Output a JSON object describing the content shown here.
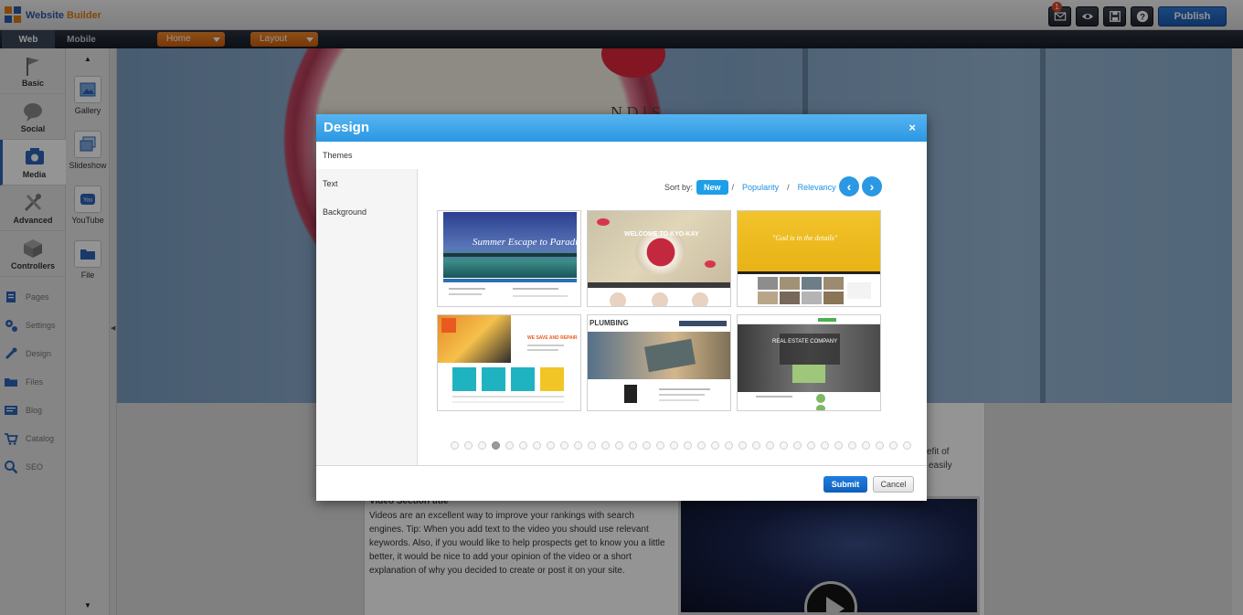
{
  "app": {
    "title": "Website Builder",
    "title_part1": "Website",
    "title_part2": "Builder"
  },
  "toolbar": {
    "messages_badge": "1",
    "publish_label": "Publish",
    "icons": [
      "mail-icon",
      "eye-icon",
      "save-icon",
      "help-icon"
    ]
  },
  "navbar": {
    "modes": [
      "Web",
      "Mobile"
    ],
    "active_mode": "Web",
    "home_dropdown": "Home",
    "layout_dropdown": "Layout"
  },
  "leftcol": {
    "categories": [
      {
        "label": "Basic",
        "icon": "flag-icon"
      },
      {
        "label": "Social",
        "icon": "chat-bubble-icon"
      },
      {
        "label": "Media",
        "icon": "media-icon",
        "active": true
      },
      {
        "label": "Advanced",
        "icon": "tools-icon"
      },
      {
        "label": "Controllers",
        "icon": "box-icon"
      }
    ],
    "links": [
      {
        "label": "Pages",
        "icon": "pages-icon"
      },
      {
        "label": "Settings",
        "icon": "gears-icon"
      },
      {
        "label": "Design",
        "icon": "brush-icon"
      },
      {
        "label": "Files",
        "icon": "folder-icon"
      },
      {
        "label": "Blog",
        "icon": "blog-icon"
      },
      {
        "label": "Catalog",
        "icon": "cart-icon"
      },
      {
        "label": "SEO",
        "icon": "magnifier-icon"
      }
    ]
  },
  "media_panel": {
    "items": [
      {
        "label": "Gallery",
        "icon": "gallery-icon"
      },
      {
        "label": "Slideshow",
        "icon": "slideshow-icon"
      },
      {
        "label": "YouTube",
        "icon": "youtube-icon"
      },
      {
        "label": "File",
        "icon": "file-folder-icon"
      }
    ]
  },
  "page": {
    "hero_title": "N  D  l   S ",
    "side_text_1": "efit of",
    "side_text_2": "easily",
    "video_section_title": "Video Section title",
    "video_section_body": "Videos are an excellent way to improve your rankings with search engines. Tip: When you add text to the video you should use relevant keywords. Also, if you would like to help prospects get to know you a little better, it would be nice to add your opinion of the video or a short explanation of why you decided to create or post it on your site."
  },
  "modal": {
    "title": "Design",
    "close": "×",
    "tabs": [
      "Themes",
      "Text",
      "Background"
    ],
    "active_tab": "Themes",
    "sort_label": "Sort by:",
    "sort_options": [
      "New",
      "Popularity",
      "Relevancy"
    ],
    "sort_active": "New",
    "sort_separator": "/",
    "prev_arrow": "‹",
    "next_arrow": "›",
    "themes": [
      {
        "name": "summer-escape",
        "text": "Summer Escape to Paradise"
      },
      {
        "name": "kyo-kay",
        "text": "WELCOME TO KYO-KAY"
      },
      {
        "name": "details",
        "text": "\"God is in the details\""
      },
      {
        "name": "handyman",
        "text": "WE SAVE AND REPAIR"
      },
      {
        "name": "plumbing",
        "text": "PLUMBING"
      },
      {
        "name": "real-estate",
        "text": "REAL ESTATE COMPANY"
      }
    ],
    "page_dots_count": 34,
    "active_page_index": 3,
    "submit_label": "Submit",
    "cancel_label": "Cancel"
  },
  "colors": {
    "accent": "#2b97e3",
    "publish": "#1b59b2",
    "dropdown": "#e87a1c"
  }
}
